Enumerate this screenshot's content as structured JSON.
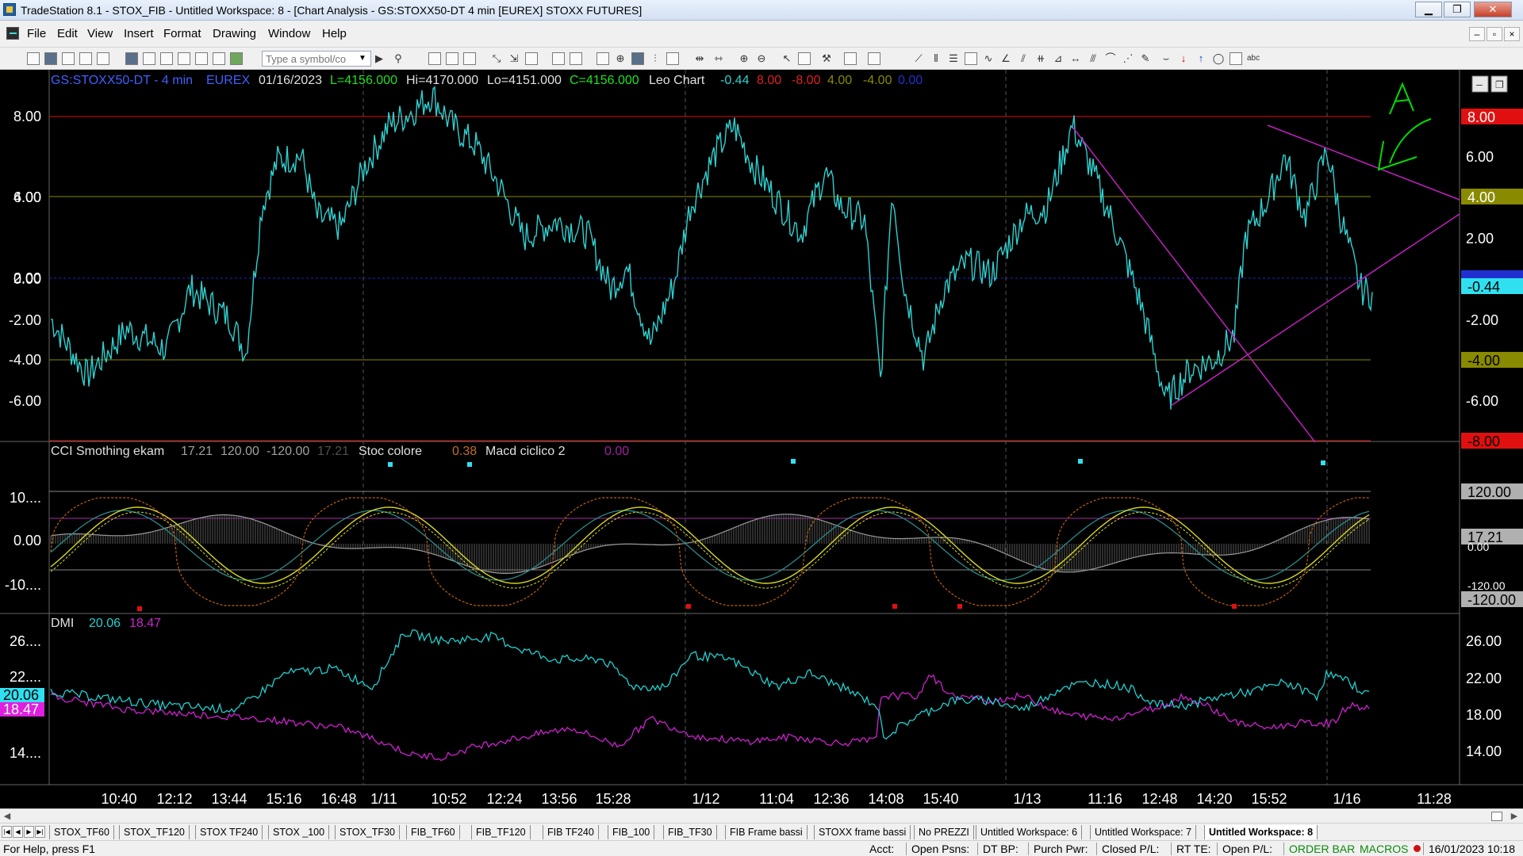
{
  "window": {
    "title": "TradeStation 8.1 - STOX_FIB - Untitled Workspace:  8 - [Chart Analysis - GS:STOXX50-DT  4 min  [EUREX] STOXX FUTURES]",
    "min_icon": "minimize-icon",
    "max_icon": "maximize-icon",
    "close_icon": "close-icon"
  },
  "menu": {
    "items": [
      "File",
      "Edit",
      "View",
      "Insert",
      "Format",
      "Drawing",
      "Window",
      "Help"
    ]
  },
  "toolbar": {
    "symbol_placeholder": "Type a symbol/co"
  },
  "chart": {
    "colors": {
      "background": "#000000",
      "price": "#2fd0d0",
      "trendline": "#c020c0",
      "red_level": "#e01010",
      "olive_level": "#8a8a00",
      "zero_level": "#2020d0",
      "annotation": "#00dd00",
      "dmi_plus": "#20d0d0",
      "dmi_minus": "#d020d0"
    },
    "price_header": {
      "symbol": "GS:STOXX50-DT - 4 min",
      "exchange": "EUREX",
      "date": "01/16/2023",
      "low_close": "L=4156.000",
      "high": "Hi=4170.000",
      "low": "Lo=4151.000",
      "close": "C=4156.000",
      "study": "Leo Chart",
      "v1": "-0.44",
      "v2": "8.00",
      "v3": "-8.00",
      "v4": "4.00",
      "v5": "-4.00",
      "v6": "0.00"
    },
    "price_axis": [
      "8.00",
      "6.00",
      "4.00",
      "2.00",
      "0.00",
      "-2.00",
      "-4.00",
      "-6.00"
    ],
    "price_right_axis": [
      "6.00",
      "2.00",
      "-2.00",
      "-6.00"
    ],
    "price_right_tags": {
      "red_high": "8.00",
      "olive_high": "4.00",
      "zero": "0.00",
      "last": "-0.44",
      "olive_low": "-4.00",
      "red_low": "-8.00"
    },
    "osc_header": {
      "cci_label": "CCI Smothing ekam",
      "cci_val": "17.21",
      "cci_hi": "120.00",
      "cci_lo": "-120.00",
      "cci_val2": "17.21",
      "stoc_label": "Stoc colore",
      "stoc_val": "0.38",
      "macd_label": "Macd ciclico 2",
      "macd_val": "0.00"
    },
    "osc_axis": [
      "10....",
      "0.00",
      "-10...."
    ],
    "osc_right_tags": {
      "hi": "120.00",
      "val": "17.21",
      "val_under": "0.00",
      "lo_over": "-120.00",
      "lo": "-120.00"
    },
    "dmi_header": {
      "label": "DMI",
      "plus": "20.06",
      "minus": "18.47"
    },
    "dmi_axis": [
      "26....",
      "22....",
      "14...."
    ],
    "dmi_right_axis": [
      "26.00",
      "22.00",
      "18.00",
      "14.00"
    ],
    "dmi_tags": {
      "plus": "20.06",
      "minus": "18.47"
    },
    "time_labels": [
      "10:40",
      "12:12",
      "13:44",
      "15:16",
      "16:48",
      "1/11",
      "10:52",
      "12:24",
      "13:56",
      "15:28",
      "1/12",
      "11:04",
      "12:36",
      "14:08",
      "15:40",
      "1/13",
      "11:16",
      "12:48",
      "14:20",
      "15:52",
      "1/16",
      "11:28"
    ],
    "chart_icons": {
      "restore": "restore-icon",
      "minimize": "minimize-icon"
    }
  },
  "tabs": [
    "STOX_TF60",
    "STOX_TF120",
    "STOX TF240",
    "STOX _100",
    "STOX_TF30",
    "FIB_TF60",
    "FIB_TF120",
    "FIB TF240",
    "FIB_100",
    "FIB_TF30",
    "FIB Frame bassi",
    "STOXX frame bassi",
    "No PREZZI",
    "Untitled Workspace:  6",
    "Untitled Workspace:  7",
    "Untitled Workspace:  8"
  ],
  "status": {
    "help": "For Help, press F1",
    "acct": "Acct:",
    "open_psns": "Open Psns:",
    "dt_bp": "DT BP:",
    "purch_pwr": "Purch Pwr:",
    "closed_pl": "Closed P/L:",
    "rt_te": "RT TE:",
    "open_pl": "Open P/L:",
    "order_bar": "ORDER BAR",
    "macros": "MACROS",
    "datetime": "16/01/2023 10:18"
  }
}
